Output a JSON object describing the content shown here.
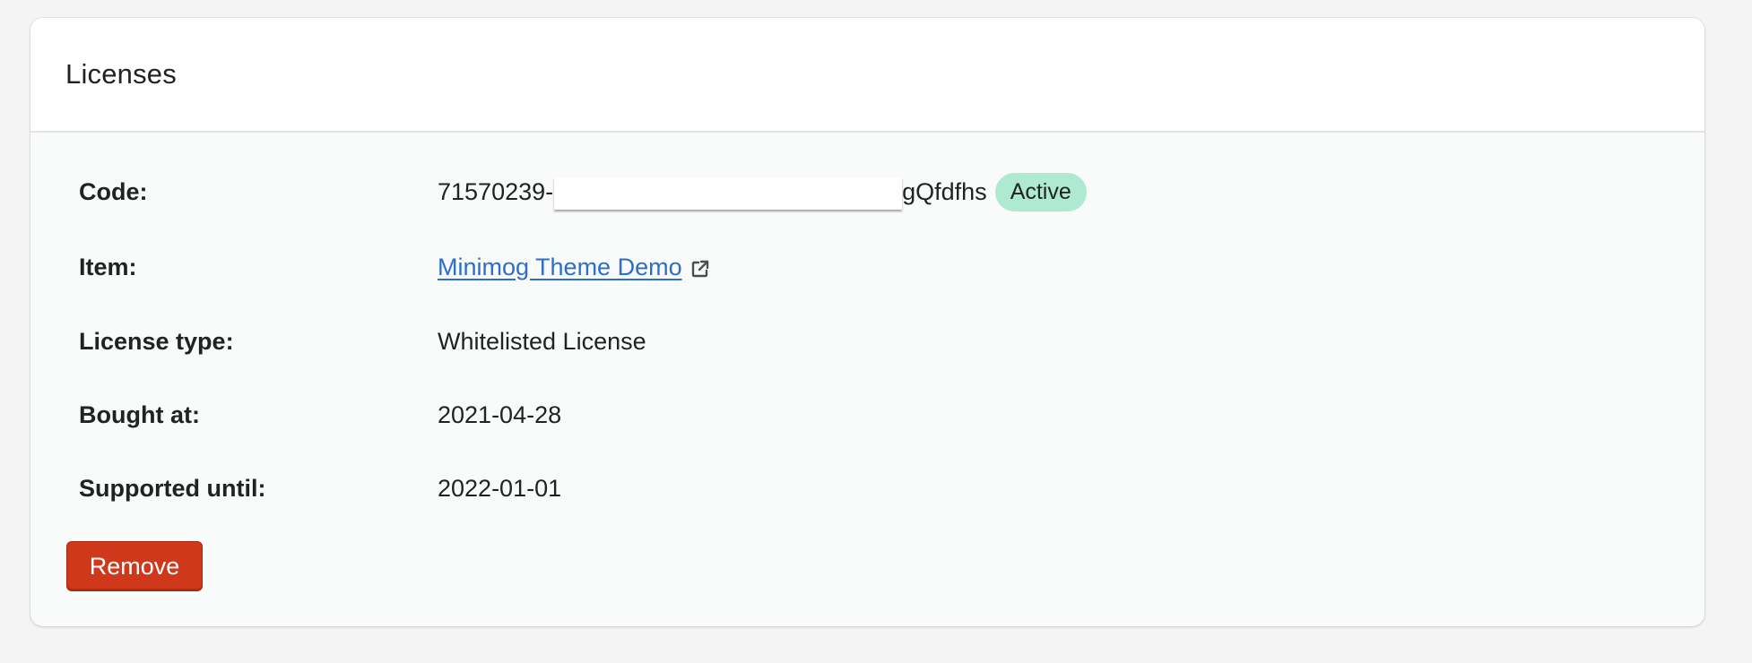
{
  "card": {
    "title": "Licenses"
  },
  "license": {
    "code_label": "Code:",
    "code_prefix": "71570239-",
    "code_suffix": "gQfdfhs",
    "status": "Active",
    "item_label": "Item:",
    "item_value": "Minimog Theme Demo",
    "type_label": "License type:",
    "type_value": "Whitelisted License",
    "bought_label": "Bought at:",
    "bought_value": "2021-04-28",
    "supported_label": "Supported until:",
    "supported_value": "2022-01-01"
  },
  "actions": {
    "remove_label": "Remove"
  },
  "colors": {
    "badge_bg": "#aee9d1",
    "link": "#2c6ecb",
    "danger": "#d0381c"
  },
  "icons": {
    "item_link": "external-link-icon"
  }
}
